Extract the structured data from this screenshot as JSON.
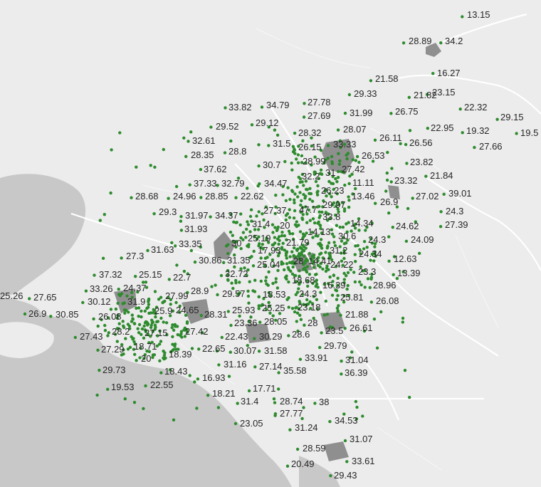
{
  "map": {
    "style": "light-grey basemap",
    "colors": {
      "land": "#ececec",
      "water": "#c7c7c7",
      "urban_area": "#8f8f8f",
      "road": "#ffffff",
      "marker": "#2e8b2e",
      "label": "#262626"
    }
  },
  "labels": [
    "13.15",
    "28.89",
    "34.2",
    "16.27",
    "21.58",
    "29.33",
    "21.82",
    "23.15",
    "33.82",
    "34.79",
    "27.78",
    "27.69",
    "31.99",
    "26.75",
    "22.32",
    "29.15",
    "19.5",
    "29.52",
    "29.12",
    "28.32",
    "28.07",
    "26.11",
    "26.56",
    "22.95",
    "19.32",
    "27.66",
    "32.61",
    "28.35",
    "28.8",
    "31.5",
    "26.15",
    "33.33",
    "26.53",
    "28.99",
    "23.82",
    "37.62",
    "30.7",
    "27.42",
    "32.2",
    "31",
    "21.84",
    "23.32",
    "39.01",
    "37.33",
    "32.79",
    "34.47",
    "11.11",
    "26.23",
    "13.46",
    "27.02",
    "28.68",
    "24.96",
    "28.85",
    "22.62",
    "29.97",
    "26.9",
    "24.3",
    "29.3",
    "31.97",
    "34.37",
    "27.37",
    "47.7",
    "33.8",
    "14.34",
    "27.39",
    "24.62",
    "31.4",
    "20",
    "31.93",
    "14.13",
    "30.6",
    "24.3",
    "24.09",
    "33.35",
    "30",
    "25.19",
    "21.79",
    "31.63",
    "17.93",
    "31.2",
    "24.34",
    "12.63",
    "27.3",
    "30.86",
    "31.35",
    "28",
    "14.41",
    "24.22",
    "25.04",
    "13.39",
    "37.32",
    "25.15",
    "32.72",
    "23.3",
    "22.7",
    "18.68",
    "16.39",
    "28.96",
    "33.26",
    "24.37",
    "27.99",
    "28.9",
    "29.57",
    "18.53",
    "24.3",
    "25.81",
    "26.08",
    "25.26",
    "27.65",
    "30.12",
    "31.9",
    "23.18",
    "26.9",
    "30.85",
    "26.08",
    "25.9",
    "24.65",
    "25.93",
    "25.25",
    "21.88",
    "28.31",
    "23.36",
    "28.05",
    "28",
    "26.61",
    "27.43",
    "28.2",
    "27.15",
    "27.42",
    "22.43",
    "30.29",
    "28.6",
    "23.5",
    "27.29",
    "18.71",
    "18.39",
    "22.65",
    "30.07",
    "31.58",
    "29.79",
    "20",
    "33.91",
    "31.04",
    "31.16",
    "29.73",
    "18.43",
    "27.14",
    "35.58",
    "36.39",
    "19.53",
    "22.55",
    "16.93",
    "17.71",
    "18.21",
    "31.4",
    "28.74",
    "38",
    "27.77",
    "23.05",
    "31.24",
    "34.53",
    "31.07",
    "28.59",
    "33.61",
    "20.49",
    "29.43"
  ]
}
